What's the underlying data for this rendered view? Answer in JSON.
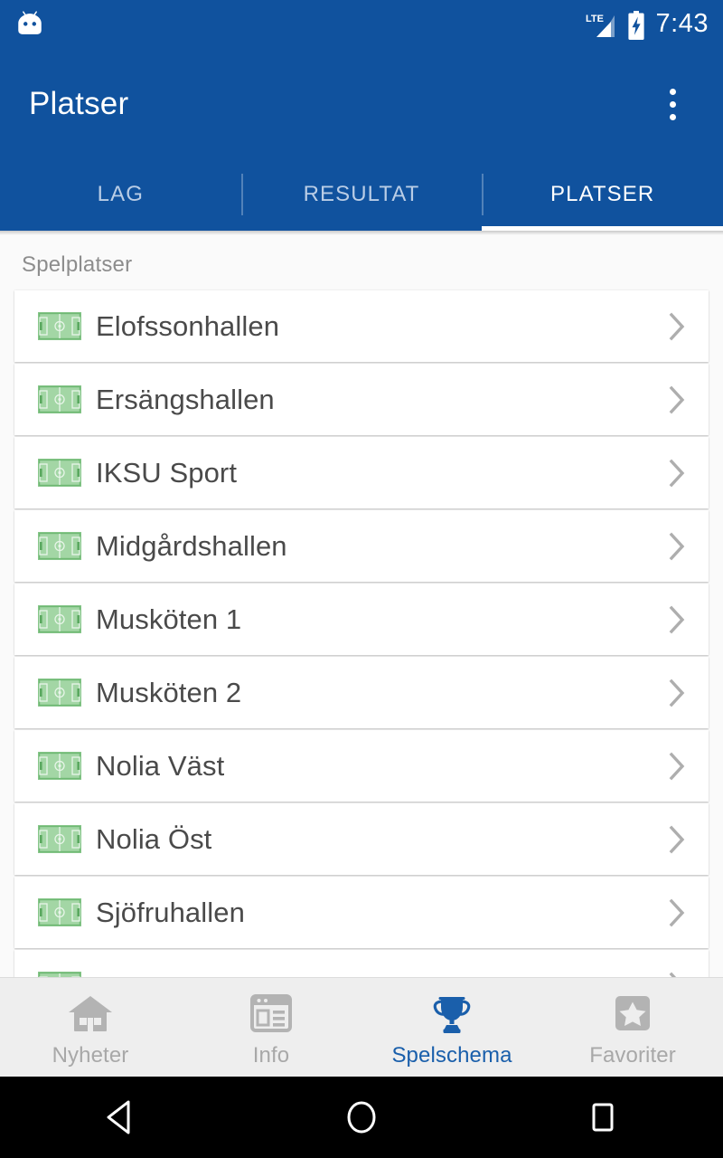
{
  "statusbar": {
    "notification_icon": "cyanogenmod-robot-icon",
    "network_label": "LTE",
    "signal_icon": "signal-bars-icon",
    "battery_icon": "battery-charging-icon",
    "clock": "7:43"
  },
  "appbar": {
    "title": "Platser",
    "overflow_icon": "overflow-menu-icon"
  },
  "tabs": [
    {
      "label": "LAG",
      "active": false
    },
    {
      "label": "RESULTAT",
      "active": false
    },
    {
      "label": "PLATSER",
      "active": true
    }
  ],
  "content": {
    "section_header": "Spelplatser",
    "row_icon": "sports-pitch-icon",
    "row_chevron": "chevron-right-icon",
    "places": [
      {
        "name": "Elofssonhallen"
      },
      {
        "name": "Ersängshallen"
      },
      {
        "name": "IKSU Sport"
      },
      {
        "name": "Midgårdshallen"
      },
      {
        "name": "Musköten 1"
      },
      {
        "name": "Musköten 2"
      },
      {
        "name": "Nolia Väst"
      },
      {
        "name": "Nolia Öst"
      },
      {
        "name": "Sjöfruhallen"
      },
      {
        "name": ""
      }
    ]
  },
  "bottomnav": [
    {
      "label": "Nyheter",
      "icon": "home-icon",
      "active": false
    },
    {
      "label": "Info",
      "icon": "article-icon",
      "active": false
    },
    {
      "label": "Spelschema",
      "icon": "trophy-icon",
      "active": true
    },
    {
      "label": "Favoriter",
      "icon": "star-icon",
      "active": false
    }
  ],
  "sysnav": [
    {
      "icon": "back-triangle-icon"
    },
    {
      "icon": "home-circle-icon"
    },
    {
      "icon": "recents-square-icon"
    }
  ],
  "colors": {
    "primary": "#10529e",
    "accent": "#1a5fab",
    "pitch_green": "#7bc47f",
    "inactive_gray": "#b3b3b3"
  }
}
